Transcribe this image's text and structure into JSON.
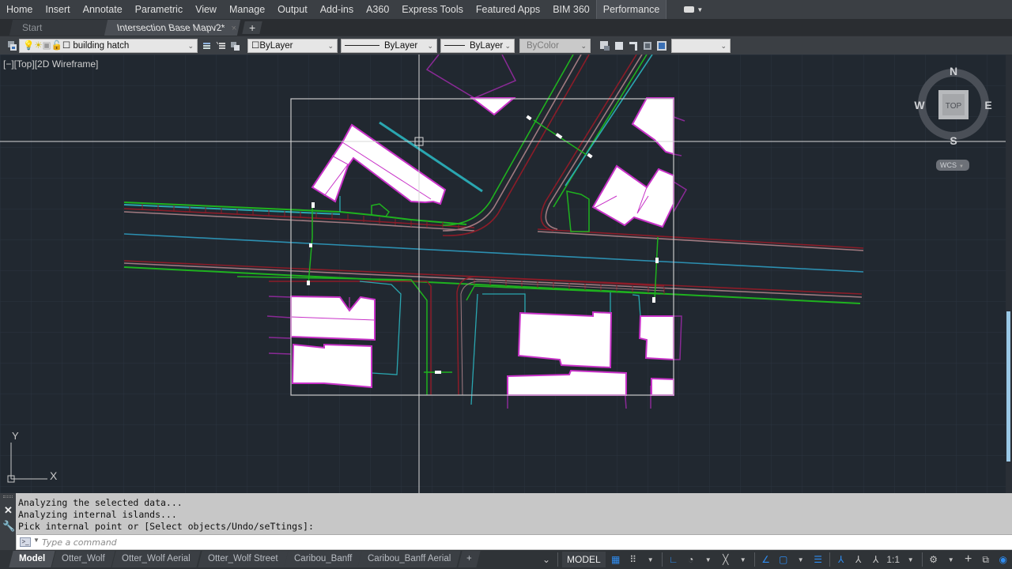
{
  "ribbon": {
    "tabs": [
      {
        "label": "Home"
      },
      {
        "label": "Insert"
      },
      {
        "label": "Annotate"
      },
      {
        "label": "Parametric"
      },
      {
        "label": "View"
      },
      {
        "label": "Manage"
      },
      {
        "label": "Output"
      },
      {
        "label": "Add-ins"
      },
      {
        "label": "A360"
      },
      {
        "label": "Express Tools"
      },
      {
        "label": "Featured Apps"
      },
      {
        "label": "BIM 360"
      },
      {
        "label": "Performance"
      }
    ],
    "active_tab": "Performance"
  },
  "doc_tabs": {
    "start": "Start",
    "active": "Intersection Base Mapv2*",
    "close": "×",
    "add": "+"
  },
  "properties": {
    "layer": "building hatch",
    "color": "ByLayer",
    "linetype": "ByLayer",
    "lineweight": "ByLayer",
    "plotstyle": "ByColor",
    "extra_combo": ""
  },
  "viewport": {
    "label": "[−][Top][2D Wireframe]",
    "viewcube": {
      "north": "N",
      "south": "S",
      "east": "E",
      "west": "W",
      "face": "TOP"
    },
    "wcs": "WCS",
    "ucs": {
      "x": "X",
      "y": "Y"
    }
  },
  "drawing_colors": {
    "background": "#212830",
    "grid": "#2c3440",
    "building_fill": "#ffffff",
    "building_outline": "#c832c8",
    "property_line": "#8a2a96",
    "curb_green": "#1fb21f",
    "road_red": "#8c1c28",
    "water_cyan": "#2aa6b0",
    "selection_box": "#c8c8c8"
  },
  "command": {
    "history": [
      "Analyzing the selected data...",
      "Analyzing internal islands...",
      "Pick internal point or [Select objects/Undo/seTtings]:"
    ],
    "placeholder": "Type a command"
  },
  "layout_tabs": [
    {
      "label": "Model"
    },
    {
      "label": "Otter_Wolf"
    },
    {
      "label": "Otter_Wolf Aerial"
    },
    {
      "label": "Otter_Wolf Street"
    },
    {
      "label": "Caribou_Banff"
    },
    {
      "label": "Caribou_Banff Aerial"
    }
  ],
  "layout_add": "+",
  "status": {
    "space": "MODEL",
    "scale": "1:1"
  }
}
